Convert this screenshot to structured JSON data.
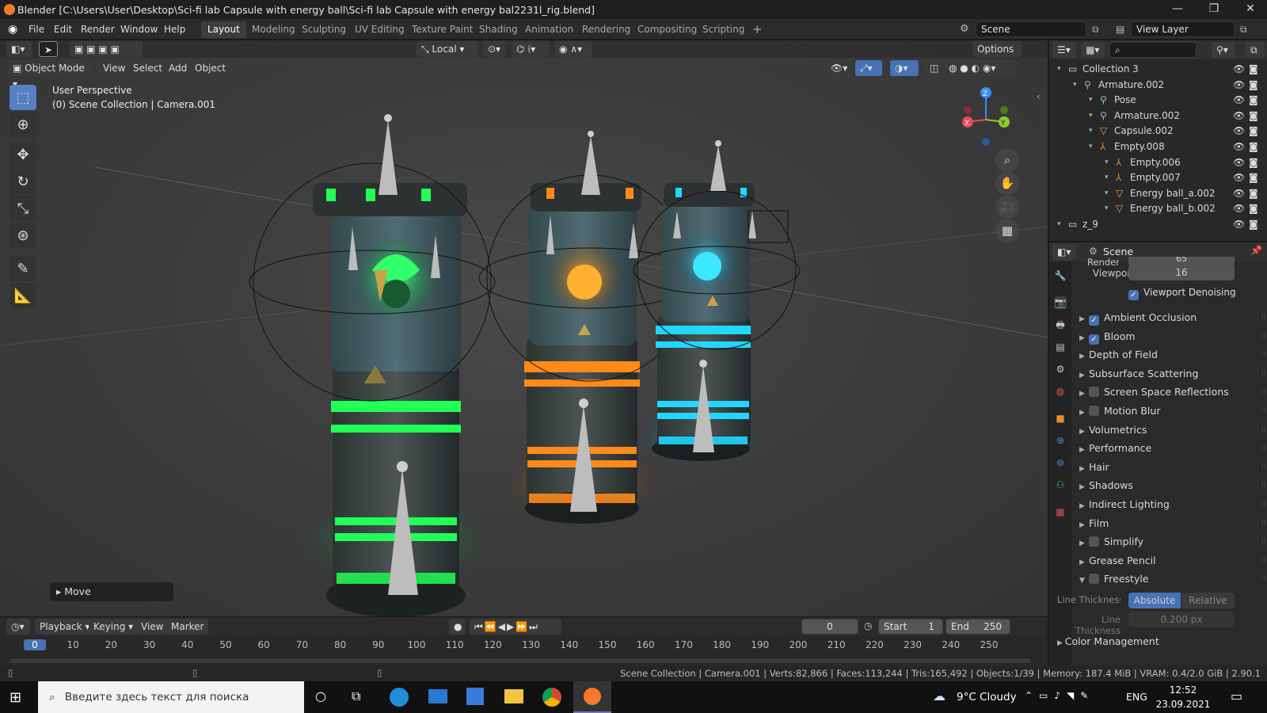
{
  "window": {
    "title": "Blender [C:\\Users\\User\\Desktop\\Sci-fi lab Capsule with energy ball\\Sci-fi lab Capsule with energy bal2231l_rig.blend]",
    "min": "—",
    "max": "❐",
    "close": "✕"
  },
  "menu": {
    "file": "File",
    "edit": "Edit",
    "render": "Render",
    "window": "Window",
    "help": "Help"
  },
  "workspaces": [
    "Layout",
    "Modeling",
    "Sculpting",
    "UV Editing",
    "Texture Paint",
    "Shading",
    "Animation",
    "Rendering",
    "Compositing",
    "Scripting"
  ],
  "scene": {
    "label": "Scene",
    "view_layer": "View Layer"
  },
  "header": {
    "transform_orientation": "Local",
    "options": "Options",
    "mode": "Object Mode",
    "view": "View",
    "select": "Select",
    "add": "Add",
    "object": "Object"
  },
  "viewport": {
    "perspective": "User Perspective",
    "collection_info": "(0) Scene Collection | Camera.001",
    "last_op": "Move"
  },
  "gizmo": {
    "x": "X",
    "y": "Y",
    "z": "Z"
  },
  "outliner": {
    "rows": [
      {
        "label": "Collection 3",
        "indent": 1,
        "icon": "collection"
      },
      {
        "label": "Armature.002",
        "indent": 2,
        "icon": "armature"
      },
      {
        "label": "Pose",
        "indent": 3,
        "icon": "pose"
      },
      {
        "label": "Armature.002",
        "indent": 3,
        "icon": "armature"
      },
      {
        "label": "Capsule.002",
        "indent": 3,
        "icon": "mesh"
      },
      {
        "label": "Empty.008",
        "indent": 3,
        "icon": "empty"
      },
      {
        "label": "Empty.006",
        "indent": 4,
        "icon": "empty"
      },
      {
        "label": "Empty.007",
        "indent": 4,
        "icon": "empty"
      },
      {
        "label": "Energy ball_a.002",
        "indent": 4,
        "icon": "mesh"
      },
      {
        "label": "Energy ball_b.002",
        "indent": 4,
        "icon": "mesh"
      },
      {
        "label": "z_9",
        "indent": 1,
        "icon": "collection"
      }
    ]
  },
  "properties": {
    "context": "Scene",
    "render_label": "Render",
    "render_value": "65",
    "viewport_label": "Viewport",
    "viewport_value": "16",
    "denoise": "Viewport Denoising",
    "panels": [
      {
        "label": "Ambient Occlusion",
        "check": true
      },
      {
        "label": "Bloom",
        "check": true
      },
      {
        "label": "Depth of Field",
        "check": null
      },
      {
        "label": "Subsurface Scattering",
        "check": null
      },
      {
        "label": "Screen Space Reflections",
        "check": false
      },
      {
        "label": "Motion Blur",
        "check": false
      },
      {
        "label": "Volumetrics",
        "check": null
      },
      {
        "label": "Performance",
        "check": null
      },
      {
        "label": "Hair",
        "check": null
      },
      {
        "label": "Shadows",
        "check": null
      },
      {
        "label": "Indirect Lighting",
        "check": null
      },
      {
        "label": "Film",
        "check": null
      },
      {
        "label": "Simplify",
        "check": false
      },
      {
        "label": "Grease Pencil",
        "check": null
      },
      {
        "label": "Freestyle",
        "check": false,
        "open": true
      }
    ],
    "line_thickness_mode": "Line Thickness ...",
    "absolute": "Absolute",
    "relative": "Relative",
    "line_thickness": "Line Thickness",
    "line_thickness_value": "0.200 px",
    "color_management": "Color Management"
  },
  "timeline": {
    "playback": "Playback",
    "keying": "Keying",
    "view": "View",
    "marker": "Marker",
    "current": "0",
    "start_label": "Start",
    "start": "1",
    "end_label": "End",
    "end": "250",
    "ticks": [
      "0",
      "10",
      "20",
      "30",
      "40",
      "50",
      "60",
      "70",
      "80",
      "90",
      "100",
      "110",
      "120",
      "130",
      "140",
      "150",
      "160",
      "170",
      "180",
      "190",
      "200",
      "210",
      "220",
      "230",
      "240",
      "250"
    ]
  },
  "status": "Scene Collection | Camera.001 | Verts:82,866 | Faces:113,244 | Tris:165,492 | Objects:1/39 | Memory: 187.4 MiB | VRAM: 0.4/2.0 GiB | 2.90.1",
  "taskbar": {
    "search": "Введите здесь текст для поиска",
    "weather": "9°C  Cloudy",
    "lang": "ENG",
    "time": "12:52",
    "date": "23.09.2021"
  },
  "colors": {
    "green": "#22ff55",
    "orange": "#ff8a1a",
    "cyan": "#20d8ff",
    "accent": "#4772b3",
    "blender": "#f5792a"
  }
}
